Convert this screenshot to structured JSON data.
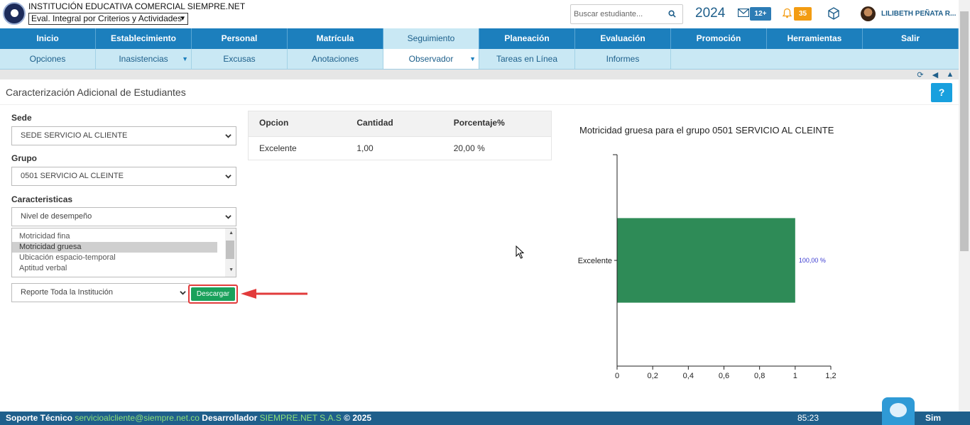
{
  "header": {
    "institution": "INSTITUCIÓN EDUCATIVA COMERCIAL SIEMPRE.NET",
    "eval_select": "Eval. Integral por Criterios y Actividades",
    "search_placeholder": "Buscar estudiante...",
    "year": "2024",
    "messages_badge": "12+",
    "notifications_badge": "35",
    "user": "LILIBETH PEÑATA R..."
  },
  "mainnav": [
    "Inicio",
    "Establecimiento",
    "Personal",
    "Matrícula",
    "Seguimiento",
    "Planeación",
    "Evaluación",
    "Promoción",
    "Herramientas",
    "Salir"
  ],
  "subnav": [
    "Opciones",
    "Inasistencias",
    "Excusas",
    "Anotaciones",
    "Observador",
    "Tareas en Línea",
    "Informes"
  ],
  "page_title": "Caracterización Adicional de Estudiantes",
  "help": "?",
  "form": {
    "sede_label": "Sede",
    "sede_value": "SEDE SERVICIO AL CLIENTE",
    "grupo_label": "Grupo",
    "grupo_value": "0501 SERVICIO AL CLEINTE",
    "caracteristicas_label": "Caracteristicas",
    "caracteristicas_value": "Nivel de desempeño",
    "list": [
      "Motricidad fina",
      "Motricidad gruesa",
      "Ubicación espacio-temporal",
      "Aptitud verbal"
    ],
    "list_selected": 1,
    "report_value": "Reporte Toda la Institución",
    "download": "Descargar"
  },
  "table": {
    "headers": [
      "Opcion",
      "Cantidad",
      "Porcentaje%"
    ],
    "rows": [
      [
        "Excelente",
        "1,00",
        "20,00 %"
      ]
    ]
  },
  "chart_data": {
    "type": "bar",
    "orientation": "horizontal",
    "title": "Motricidad gruesa para el grupo 0501 SERVICIO AL CLEINTE",
    "categories": [
      "Excelente"
    ],
    "values": [
      1
    ],
    "data_labels": [
      "100,00 %"
    ],
    "xlim": [
      0,
      1.2
    ],
    "x_ticks": [
      "0",
      "0,2",
      "0,4",
      "0,6",
      "0,8",
      "1",
      "1,2"
    ],
    "bar_color": "#2e8b57",
    "label_color": "#3b3bd1",
    "grid": false
  },
  "footer": {
    "support_label": "Soporte Técnico",
    "support_email": "servicioalcliente@siempre.net.co",
    "dev_label": "Desarrollador",
    "dev_name": "SIEMPRE.NET S.A.S",
    "copyright": "© 2025",
    "time": "85:23",
    "brand": "Sim"
  }
}
